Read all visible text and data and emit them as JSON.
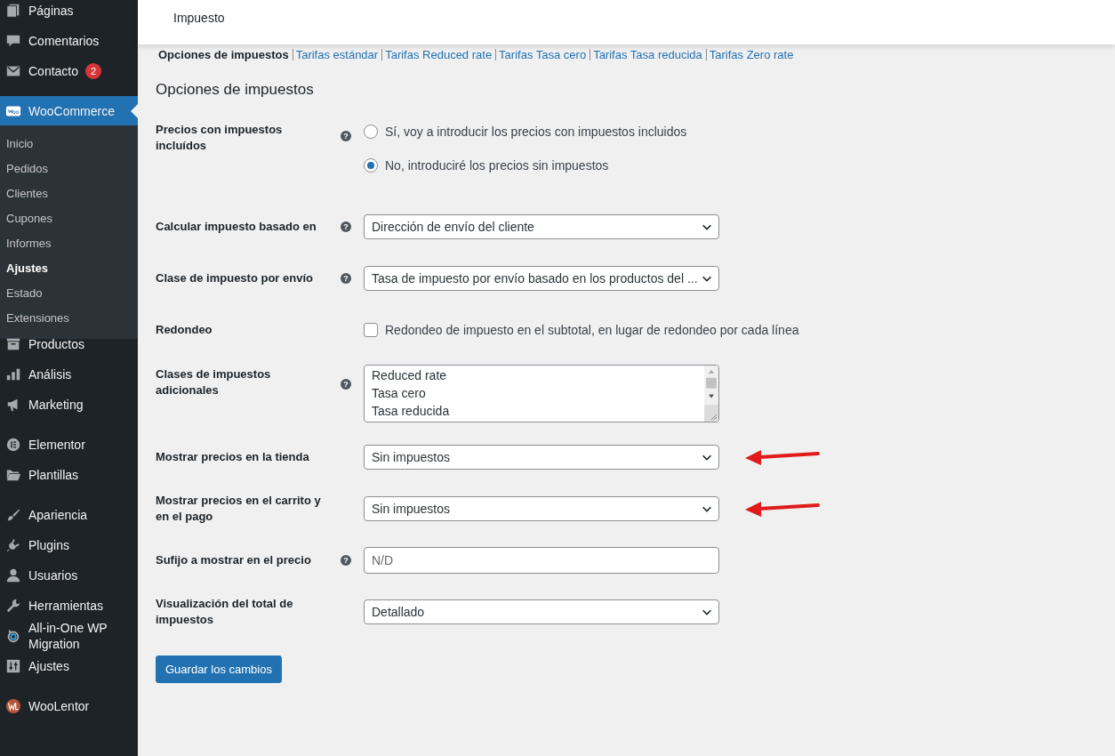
{
  "sidebar": {
    "groups": [
      [
        {
          "label": "Páginas"
        },
        {
          "label": "Comentarios"
        },
        {
          "label": "Contacto",
          "badge": "2"
        }
      ],
      [
        {
          "label": "WooCommerce",
          "selected": true,
          "children": [
            {
              "label": "Inicio",
              "selected": false
            },
            {
              "label": "Pedidos",
              "selected": false
            },
            {
              "label": "Clientes",
              "selected": false
            },
            {
              "label": "Cupones",
              "selected": false
            },
            {
              "label": "Informes",
              "selected": false
            },
            {
              "label": "Ajustes",
              "selected": true
            },
            {
              "label": "Estado",
              "selected": false
            },
            {
              "label": "Extensiones",
              "selected": false
            }
          ]
        },
        {
          "label": "Productos",
          "selected": false
        },
        {
          "label": "Análisis",
          "selected": false
        },
        {
          "label": "Marketing",
          "selected": false
        }
      ],
      [
        {
          "label": "Elementor",
          "selected": false
        },
        {
          "label": "Plantillas",
          "selected": false
        }
      ],
      [
        {
          "label": "Apariencia",
          "selected": false
        },
        {
          "label": "Plugins",
          "selected": false
        },
        {
          "label": "Usuarios",
          "selected": false
        },
        {
          "label": "Herramientas",
          "selected": false
        },
        {
          "label": "All-in-One WP Migration",
          "selected": false
        },
        {
          "label": "Ajustes",
          "selected": false
        }
      ],
      [
        {
          "label": "WooLentor",
          "selected": false
        }
      ]
    ]
  },
  "header": {
    "title": "Impuesto"
  },
  "subtabs": [
    {
      "label": "Opciones de impuestos",
      "selected": true
    },
    {
      "label": "Tarifas estándar",
      "selected": false
    },
    {
      "label": "Tarifas Reduced rate",
      "selected": false
    },
    {
      "label": "Tarifas Tasa cero",
      "selected": false
    },
    {
      "label": "Tarifas Tasa reducida",
      "selected": false
    },
    {
      "label": "Tarifas Zero rate",
      "selected": false
    }
  ],
  "section_title": "Opciones de impuestos",
  "settings": [
    {
      "kind": "radio",
      "label": "Precios con impuestos incluídos",
      "help": "?",
      "options": [
        {
          "label": "Sí, voy a introducir los precios con impuestos incluidos",
          "selected": false
        },
        {
          "label": "No, introduciré los precios sin impuestos",
          "selected": true
        }
      ]
    },
    {
      "kind": "select",
      "label": "Calcular impuesto basado en",
      "help": "?",
      "value": "Dirección de envío del cliente"
    },
    {
      "kind": "select",
      "label": "Clase de impuesto por envío",
      "help": "?",
      "value": "Tasa de impuesto por envío basado en los productos del ..."
    },
    {
      "kind": "checkbox",
      "label": "Redondeo",
      "text": "Redondeo de impuesto en el subtotal, en lugar de redondeo por cada línea",
      "checked": false
    },
    {
      "kind": "textarea",
      "label": "Clases de impuestos adicionales",
      "help": "?",
      "lines": [
        "Reduced rate",
        "Tasa cero",
        "Tasa reducida"
      ]
    },
    {
      "kind": "select",
      "label": "Mostrar precios en la tienda",
      "value": "Sin impuestos",
      "arrow": true
    },
    {
      "kind": "select",
      "label": "Mostrar precios en el carrito y en el pago",
      "value": "Sin impuestos",
      "arrow": true
    },
    {
      "kind": "text",
      "label": "Sufijo a mostrar en el precio",
      "help": "?",
      "placeholder": "N/D"
    },
    {
      "kind": "select",
      "label": "Visualización del total de impuestos",
      "value": "Detallado"
    }
  ],
  "save_button": "Guardar los cambios"
}
